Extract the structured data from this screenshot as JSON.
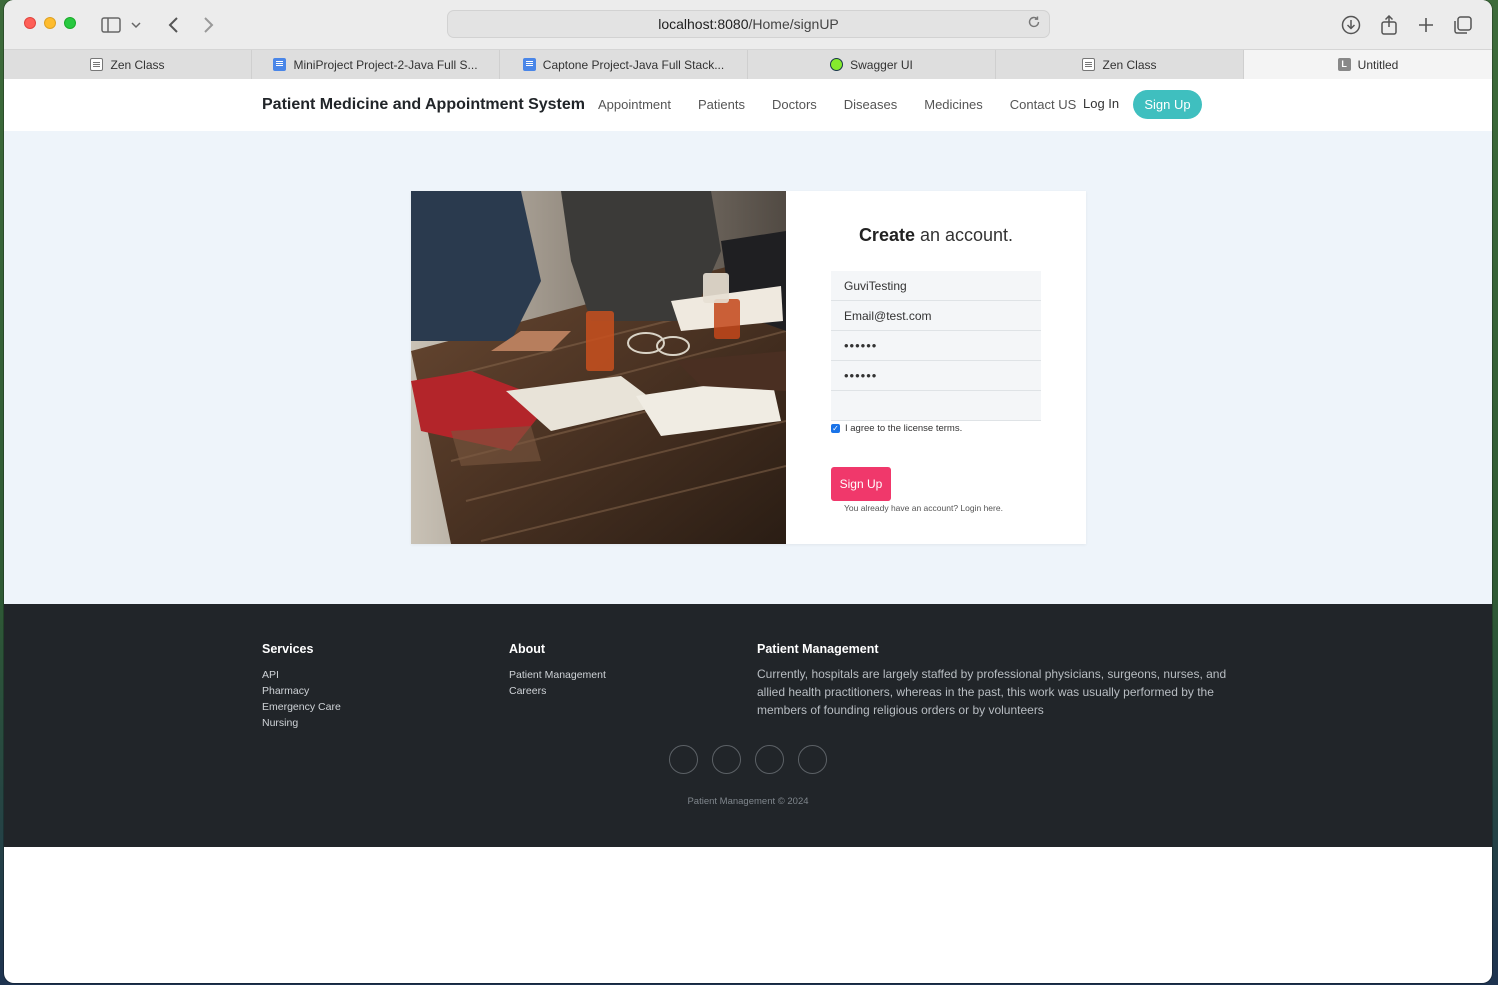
{
  "browser": {
    "url_host": "localhost:8080",
    "url_path": "/Home/signUP",
    "tabs": [
      {
        "label": "Zen Class",
        "icon": "zen-class-favicon"
      },
      {
        "label": "MiniProject Project-2-Java Full S...",
        "icon": "google-docs-favicon"
      },
      {
        "label": "Captone Project-Java Full Stack...",
        "icon": "google-docs-favicon"
      },
      {
        "label": "Swagger UI",
        "icon": "swagger-favicon"
      },
      {
        "label": "Zen Class",
        "icon": "zen-class-favicon"
      },
      {
        "label": "Untitled",
        "icon": "letter-l-favicon",
        "favicon_letter": "L",
        "active": true
      }
    ]
  },
  "nav": {
    "brand": "Patient Medicine and Appointment System",
    "links": [
      "Appointment",
      "Patients",
      "Doctors",
      "Diseases",
      "Medicines",
      "Contact US"
    ],
    "login": "Log In",
    "signup": "Sign Up"
  },
  "form": {
    "title_bold": "Create",
    "title_rest": " an account.",
    "username": "GuviTesting",
    "email": "Email@test.com",
    "password": "••••••",
    "confirm_password": "••••••",
    "extra": "",
    "agree_label": "I agree to the license terms.",
    "agree_checked": true,
    "submit": "Sign Up",
    "login_hint": "You already have an account? Login here."
  },
  "footer": {
    "services_title": "Services",
    "services": [
      "API",
      "Pharmacy",
      "Emergency Care",
      "Nursing"
    ],
    "about_title": "About",
    "about": [
      "Patient Management",
      "Careers"
    ],
    "pm_title": "Patient Management",
    "pm_text": "Currently, hospitals are largely staffed by professional physicians, surgeons, nurses, and allied health practitioners, whereas in the past, this work was usually performed by the members of founding religious orders or by volunteers",
    "copyright": "Patient Management © 2024"
  },
  "colors": {
    "signup_pill": "#3fbfbf",
    "submit_button": "#f0386b",
    "footer_bg": "#212529",
    "page_bg": "#eef4fa"
  }
}
